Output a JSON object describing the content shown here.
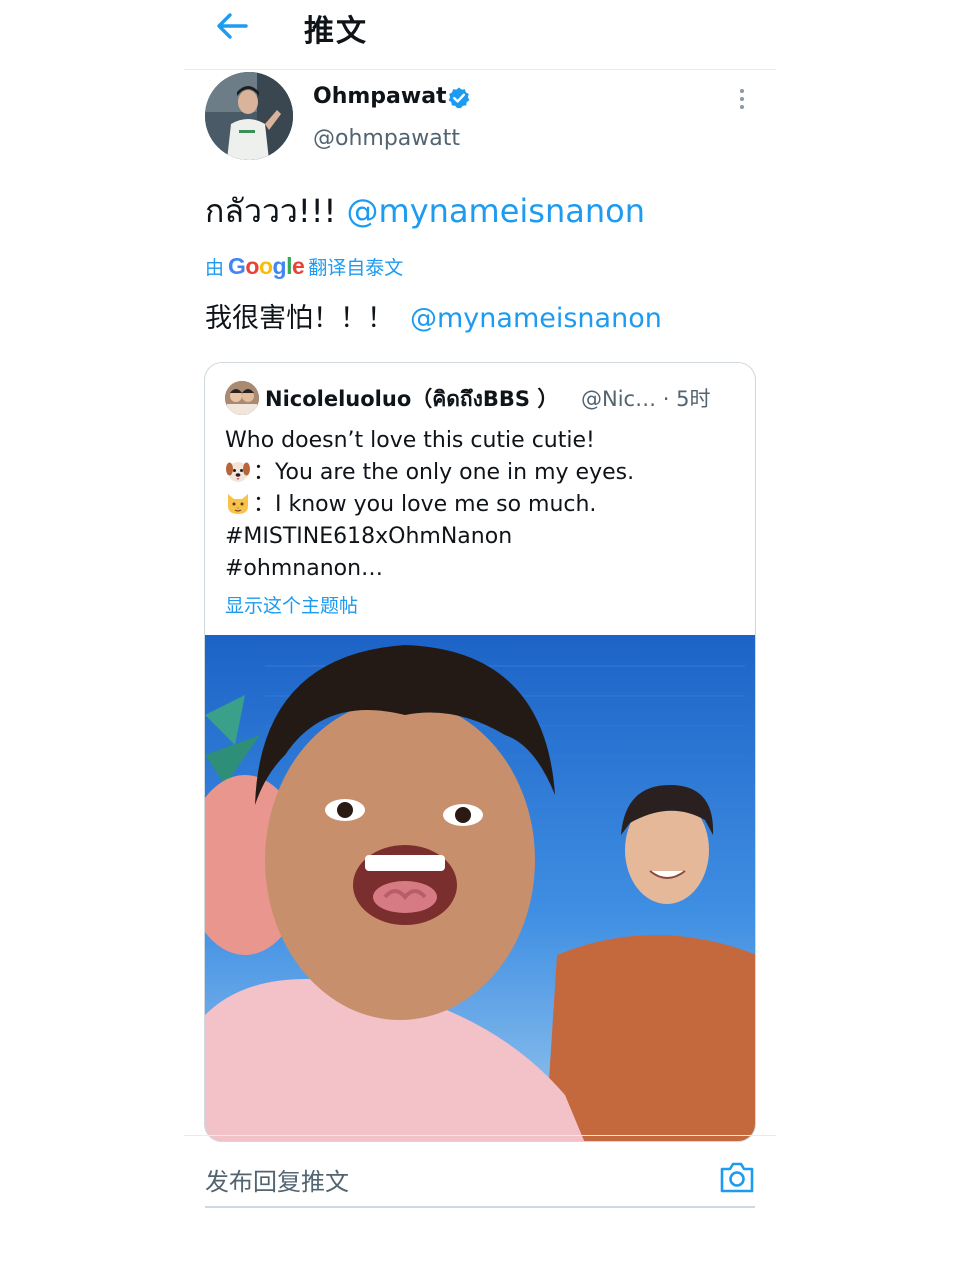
{
  "header": {
    "title": "推文"
  },
  "tweet": {
    "author": {
      "name": "Ohmpawat",
      "handle": "@ohmpawatt"
    },
    "text": "กลัววว!!! ",
    "mention": "@mynameisnanon",
    "translation": {
      "prefix": "由",
      "brand": "Google",
      "suffix": "翻译自泰文"
    },
    "translated_text": "我很害怕！！！",
    "translated_mention": "@mynameisnanon"
  },
  "quote": {
    "name": "Nicoleluoluo（คิดถึงBBS ）",
    "handle": "@Nic…",
    "separator": "·",
    "time": "5时",
    "lines": [
      "Who doesn’t love this cutie cutie!",
      "：You are the only one in my eyes.",
      "：I know you love me so much.",
      "#MISTINE618xOhmNanon",
      "#ohmnanon…"
    ],
    "show_thread": "显示这个主题帖"
  },
  "reply": {
    "placeholder": "发布回复推文"
  },
  "colors": {
    "accent": "#1d9bf0",
    "text": "#0f1419",
    "secondary": "#536471",
    "border": "#cfd9de"
  },
  "icons": {
    "back": "arrow-left-icon",
    "verified": "verified-badge-icon",
    "more": "vertical-dots-icon",
    "camera": "camera-icon",
    "dog": "dog-face-emoji",
    "cat": "cat-face-emoji"
  }
}
